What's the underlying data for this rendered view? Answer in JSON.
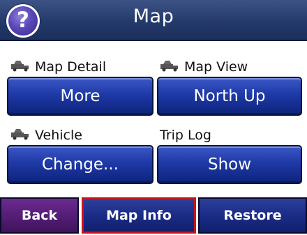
{
  "header": {
    "title": "Map",
    "help_glyph": "?"
  },
  "options": [
    {
      "label": "Map Detail",
      "icon": "vehicle-icon",
      "button": "More"
    },
    {
      "label": "Map View",
      "icon": "vehicle-icon",
      "button": "North Up"
    },
    {
      "label": "Vehicle",
      "icon": "vehicle-icon",
      "button": "Change..."
    },
    {
      "label": "Trip Log",
      "icon": "",
      "button": "Show"
    }
  ],
  "bottom_nav": {
    "back": "Back",
    "map_info": "Map Info",
    "restore": "Restore",
    "selected": "map_info"
  },
  "colors": {
    "header_bg": "#243a6b",
    "button_blue": "#1f3aa6",
    "back_purple": "#531d74",
    "selection_red": "#c4161c"
  }
}
